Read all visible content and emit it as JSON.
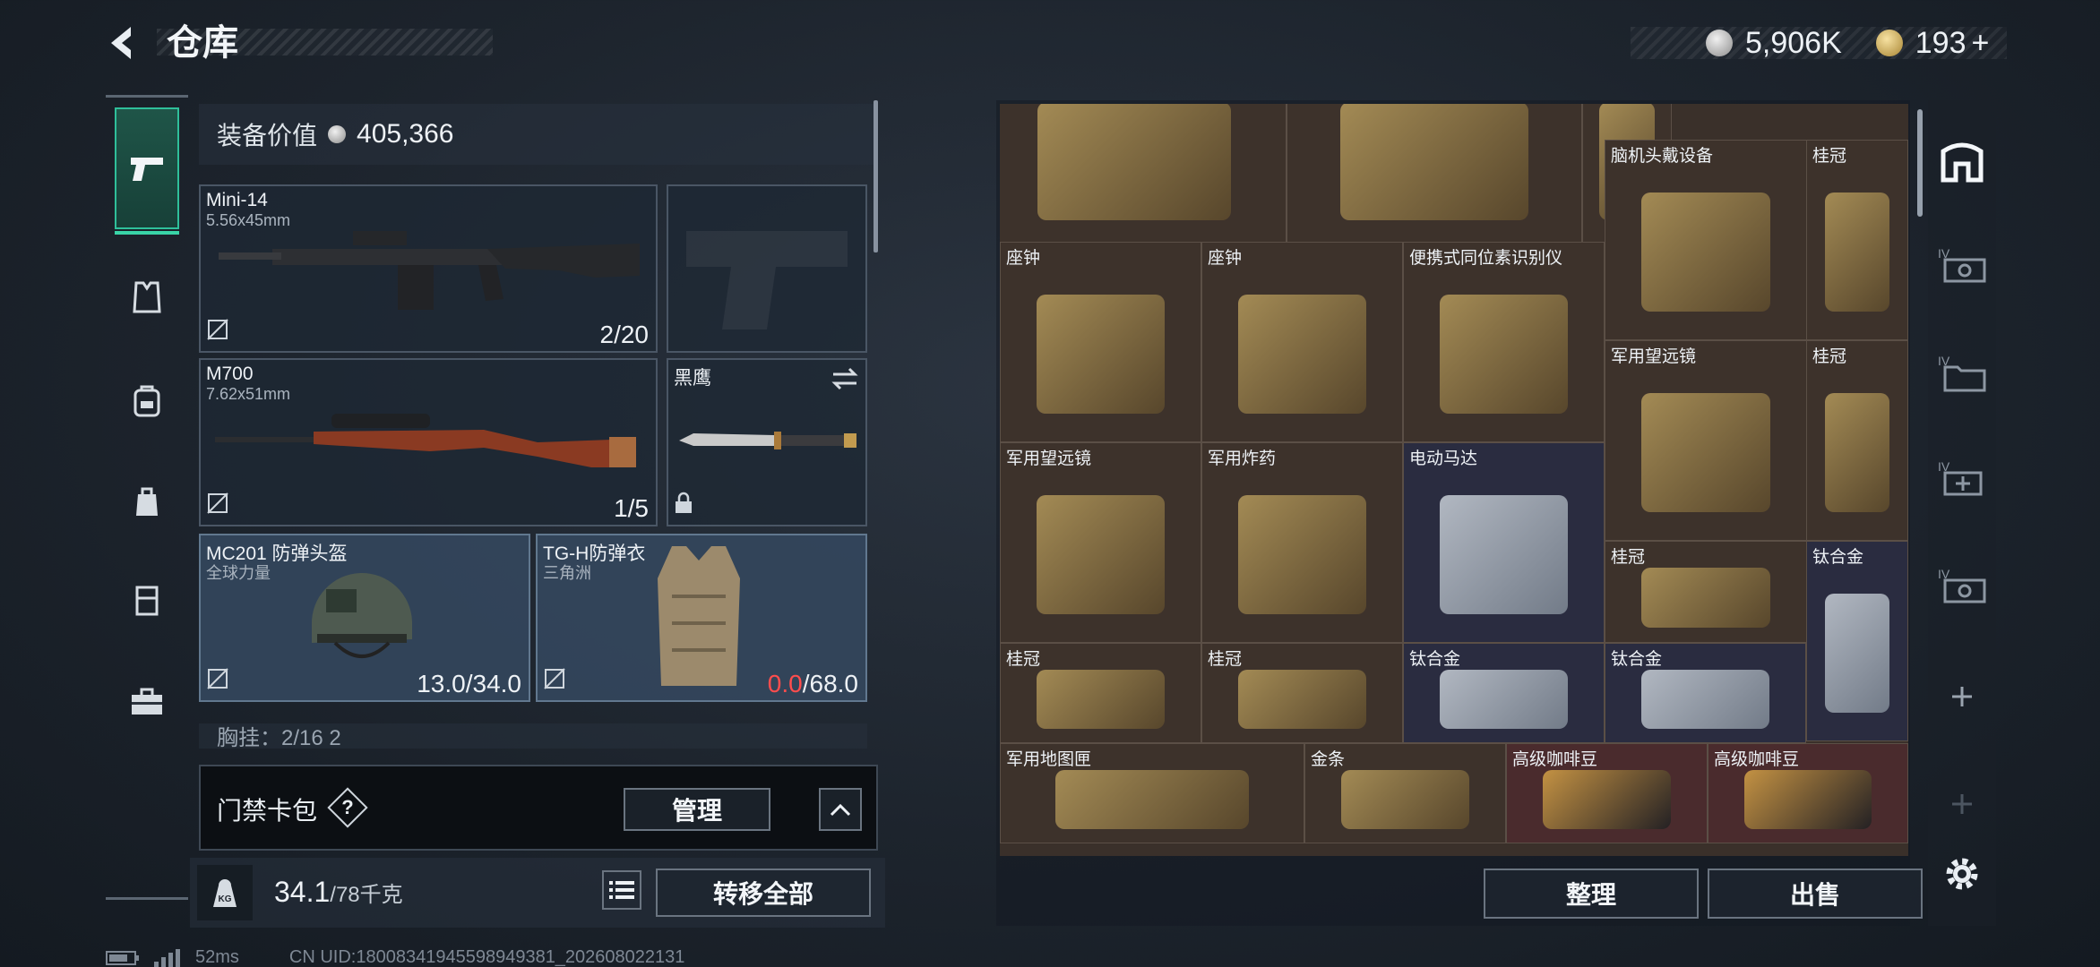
{
  "header": {
    "title": "仓库",
    "silver_amount": "5,906K",
    "gold_amount": "193",
    "plus": "+"
  },
  "loadout": {
    "value_label": "装备价值",
    "value": "405,366",
    "slots": [
      {
        "name": "Mini-14",
        "sub": "5.56x45mm",
        "count": "2/20"
      },
      {
        "name": "",
        "sub": "",
        "count": ""
      },
      {
        "name": "M700",
        "sub": "7.62x51mm",
        "count": "1/5"
      },
      {
        "name": "黑鹰",
        "sub": "",
        "count": ""
      },
      {
        "name": "MC201 防弹头盔",
        "sub": "全球力量",
        "count_a": "13.0",
        "count_b": "/34.0"
      },
      {
        "name": "TG-H防弹衣",
        "sub": "三角洲",
        "count_a": "0.0",
        "count_b": "/68.0"
      }
    ],
    "partial_row": "胸挂：2/16   2",
    "card_pack": {
      "label": "门禁卡包",
      "help": "?",
      "manage": "管理"
    },
    "weight": {
      "value": "34.1",
      "max": "/78千克"
    },
    "transfer_all": "转移全部"
  },
  "stash": {
    "items": [
      {
        "name": "",
        "color": "brown"
      },
      {
        "name": "",
        "color": "brown"
      },
      {
        "name": "",
        "color": "brown"
      },
      {
        "name": "脑机头戴设备",
        "color": "brown"
      },
      {
        "name": "桂冠",
        "color": "brown"
      },
      {
        "name": "座钟",
        "color": "brown"
      },
      {
        "name": "座钟",
        "color": "brown"
      },
      {
        "name": "便携式同位素识别仪",
        "color": "brown"
      },
      {
        "name": "军用望远镜",
        "color": "brown"
      },
      {
        "name": "桂冠",
        "color": "brown"
      },
      {
        "name": "军用望远镜",
        "color": "brown"
      },
      {
        "name": "军用炸药",
        "color": "brown"
      },
      {
        "name": "电动马达",
        "color": "blue"
      },
      {
        "name": "桂冠",
        "color": "brown"
      },
      {
        "name": "钛合金",
        "color": "blue"
      },
      {
        "name": "桂冠",
        "color": "brown"
      },
      {
        "name": "桂冠",
        "color": "brown"
      },
      {
        "name": "钛合金",
        "color": "blue"
      },
      {
        "name": "钛合金",
        "color": "blue"
      },
      {
        "name": "军用地图匣",
        "color": "brown"
      },
      {
        "name": "金条",
        "color": "brown"
      },
      {
        "name": "高级咖啡豆",
        "color": "red"
      },
      {
        "name": "高级咖啡豆",
        "color": "red"
      }
    ],
    "sort": "整理",
    "sell": "出售"
  },
  "status": {
    "ping": "52ms",
    "uid": "CN UID:18008341945598949381_202608022131"
  }
}
